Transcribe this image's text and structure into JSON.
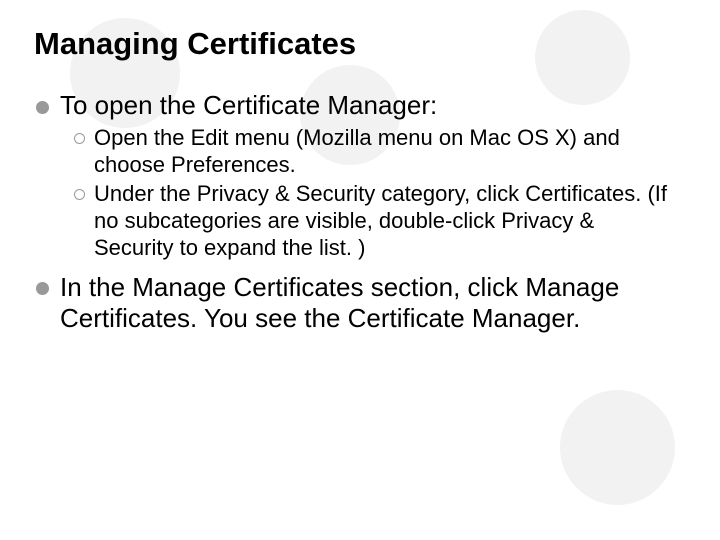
{
  "title": "Managing Certificates",
  "bullets": [
    {
      "text": "To open the Certificate Manager:",
      "sub": [
        "Open the Edit menu (Mozilla menu on Mac OS X) and choose Preferences.",
        "Under the Privacy & Security category, click Certificates. (If no subcategories are visible, double-click Privacy & Security to expand the list. )"
      ]
    },
    {
      "text": "In the Manage Certificates section, click Manage Certificates. You see the Certificate Manager.",
      "sub": []
    }
  ]
}
